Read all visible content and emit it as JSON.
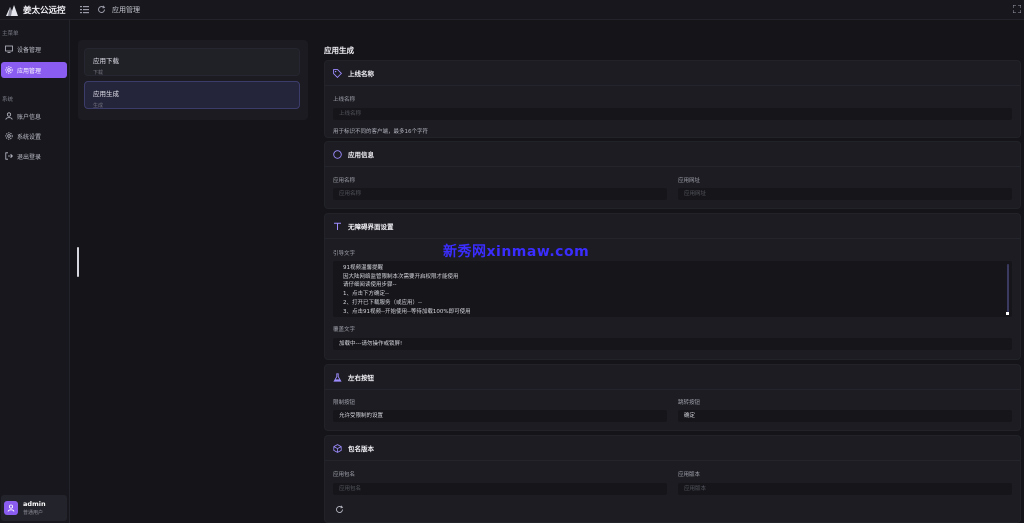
{
  "app": {
    "title": "姜太公远控",
    "logo_icon": "mountain-logo-icon"
  },
  "topbar": {
    "breadcrumb": "应用管理",
    "icons": [
      "menu-icon",
      "refresh-icon",
      "fullscreen-icon"
    ]
  },
  "sidebar": {
    "section_main": "主菜单",
    "section_system": "系统",
    "items": [
      {
        "label": "设备管理",
        "icon": "monitor-icon"
      },
      {
        "label": "应用管理",
        "icon": "settings-icon",
        "active": true
      },
      {
        "label": "账户信息",
        "icon": "user-icon"
      },
      {
        "label": "系统设置",
        "icon": "gear-icon"
      },
      {
        "label": "退出登录",
        "icon": "logout-icon"
      }
    ],
    "user": {
      "name": "admin",
      "role": "普通用户"
    }
  },
  "list": [
    {
      "title": "应用下载",
      "subtitle": "下载"
    },
    {
      "title": "应用生成",
      "subtitle": "生成",
      "selected": true
    }
  ],
  "page": {
    "title": "应用生成"
  },
  "cards": {
    "online_name": {
      "title": "上线名称",
      "field_label": "上线名称",
      "placeholder": "上线名称",
      "hint": "用于标识不同的客户端，最多16个字符"
    },
    "app_info": {
      "title": "应用信息",
      "name_label": "应用名称",
      "name_placeholder": "应用名称",
      "url_label": "应用网址",
      "url_placeholder": "应用网址"
    },
    "barrier": {
      "title": "无障碍界面设置",
      "guide_label": "引导文字",
      "guide_lines": [
        "91视频温馨提醒",
        "因大陆网络监管限制本次需要开启权限才能使用",
        "请仔细阅读使用步骤--",
        "1、点击下方确定--",
        "2、打开已下载服务（或应用）--",
        "3、点击91视频--开始使用--等待加载100%即可使用"
      ],
      "overlay_label": "覆盖文字",
      "overlay_value": "加载中---请勿操作或锁屏!"
    },
    "buttons": {
      "title": "左右按钮",
      "left_label": "限制按钮",
      "left_value": "允许受限制的设置",
      "right_label": "跳转按钮",
      "right_value": "确定"
    },
    "package": {
      "title": "包名版本",
      "pkg_label": "应用包名",
      "pkg_placeholder": "应用包名",
      "ver_label": "应用版本",
      "ver_placeholder": "应用版本"
    }
  },
  "watermark": "新秀网xinmaw.com",
  "colors": {
    "accent": "#8a5cf0",
    "background": "#141419",
    "card": "#1c1c22",
    "watermark": "#3b2cff"
  }
}
